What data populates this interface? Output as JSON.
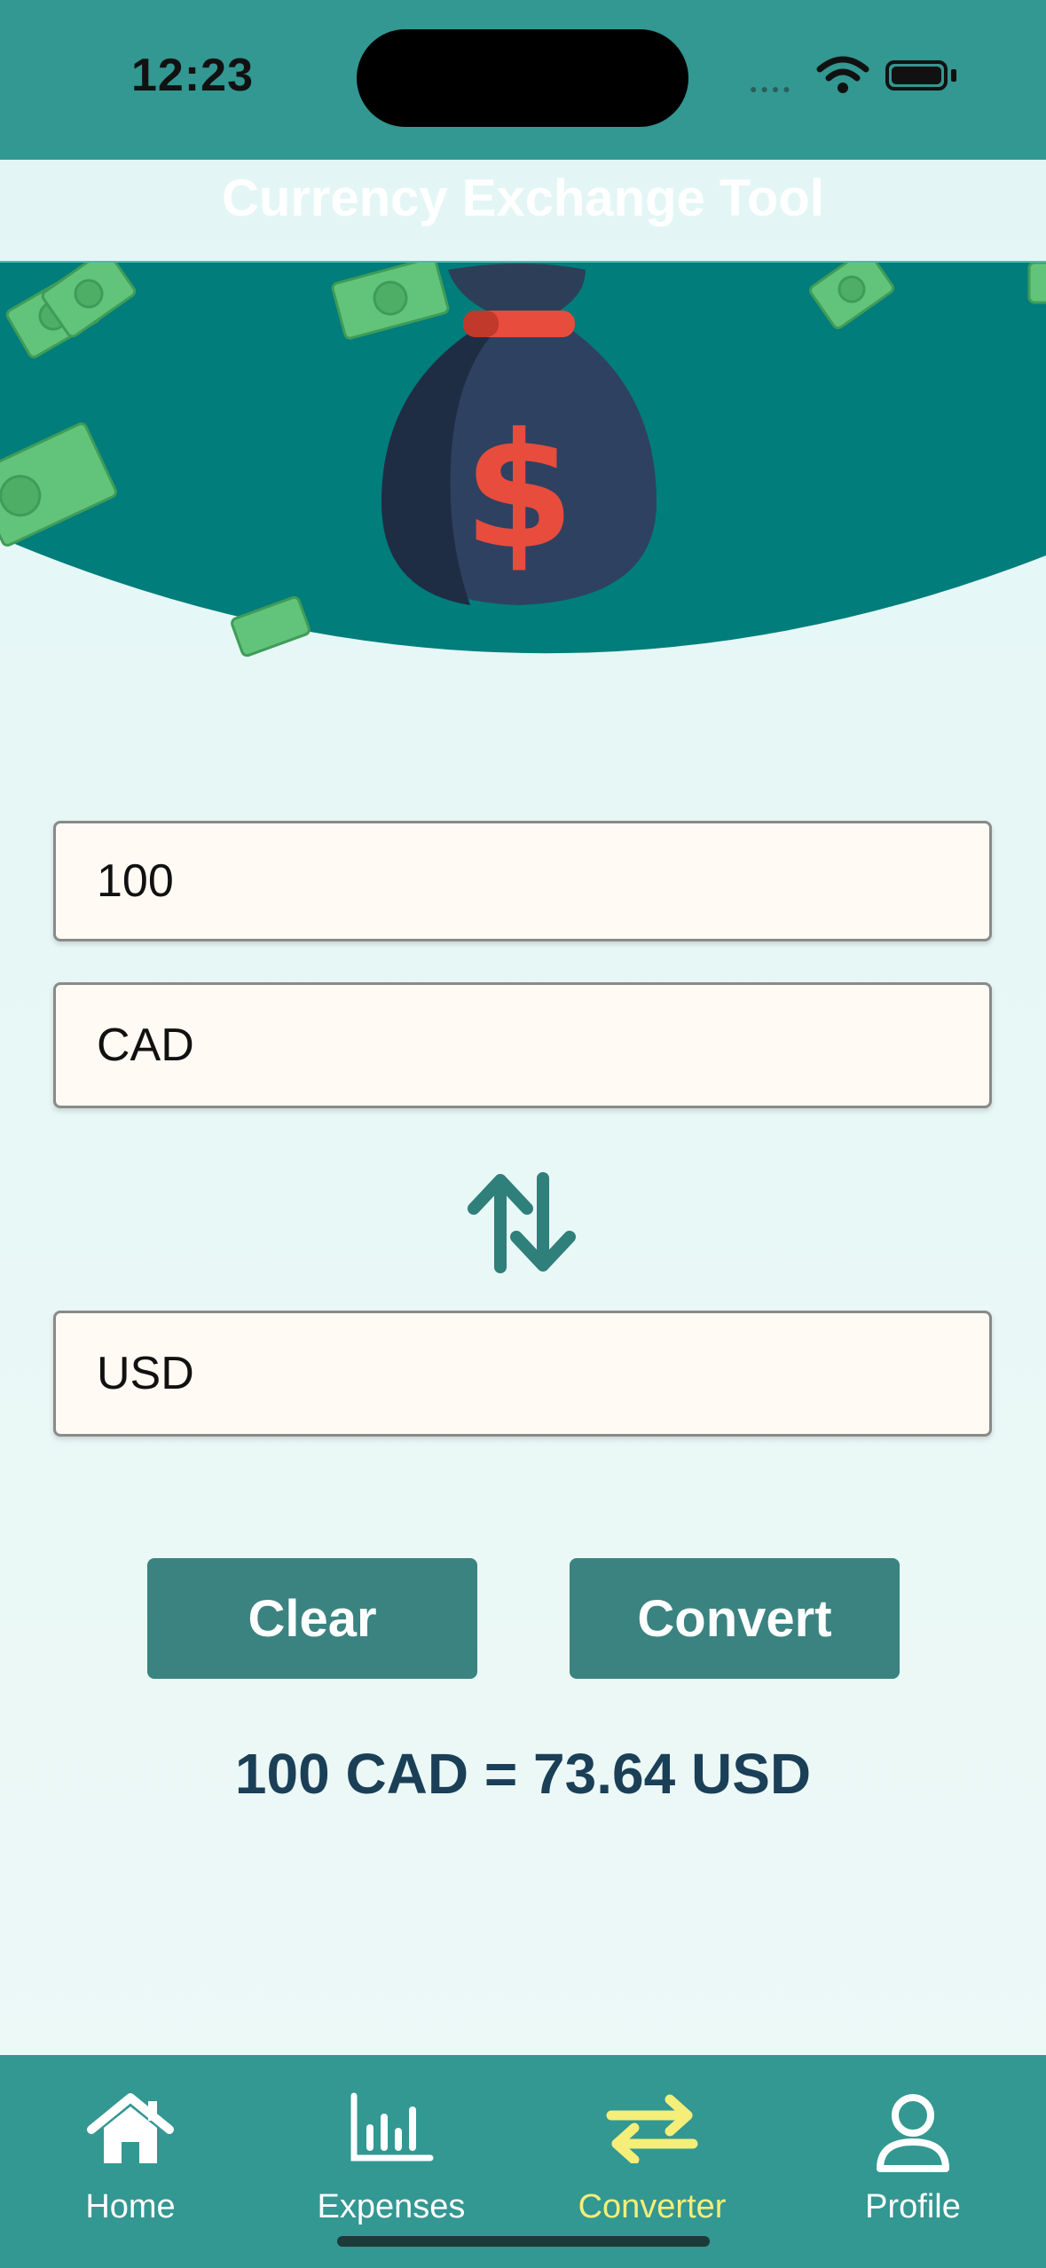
{
  "status_bar": {
    "time": "12:23"
  },
  "header": {
    "title": "Currency Exchange Tool"
  },
  "form": {
    "amount_value": "100",
    "from_currency_value": "CAD",
    "to_currency_value": "USD"
  },
  "actions": {
    "clear_label": "Clear",
    "convert_label": "Convert"
  },
  "result": {
    "text": "100 CAD = 73.64 USD"
  },
  "tab_bar": {
    "items": [
      {
        "label": "Home",
        "icon": "home-icon",
        "active": false
      },
      {
        "label": "Expenses",
        "icon": "bar-chart-icon",
        "active": false
      },
      {
        "label": "Converter",
        "icon": "exchange-arrows-icon",
        "active": true
      },
      {
        "label": "Profile",
        "icon": "user-icon",
        "active": false
      }
    ]
  },
  "colors": {
    "header_bg": "#339792",
    "hero_bg": "#017d7b",
    "button_bg": "#3a8380",
    "active_tab": "#f5ee78",
    "result_text": "#1a3f57"
  }
}
